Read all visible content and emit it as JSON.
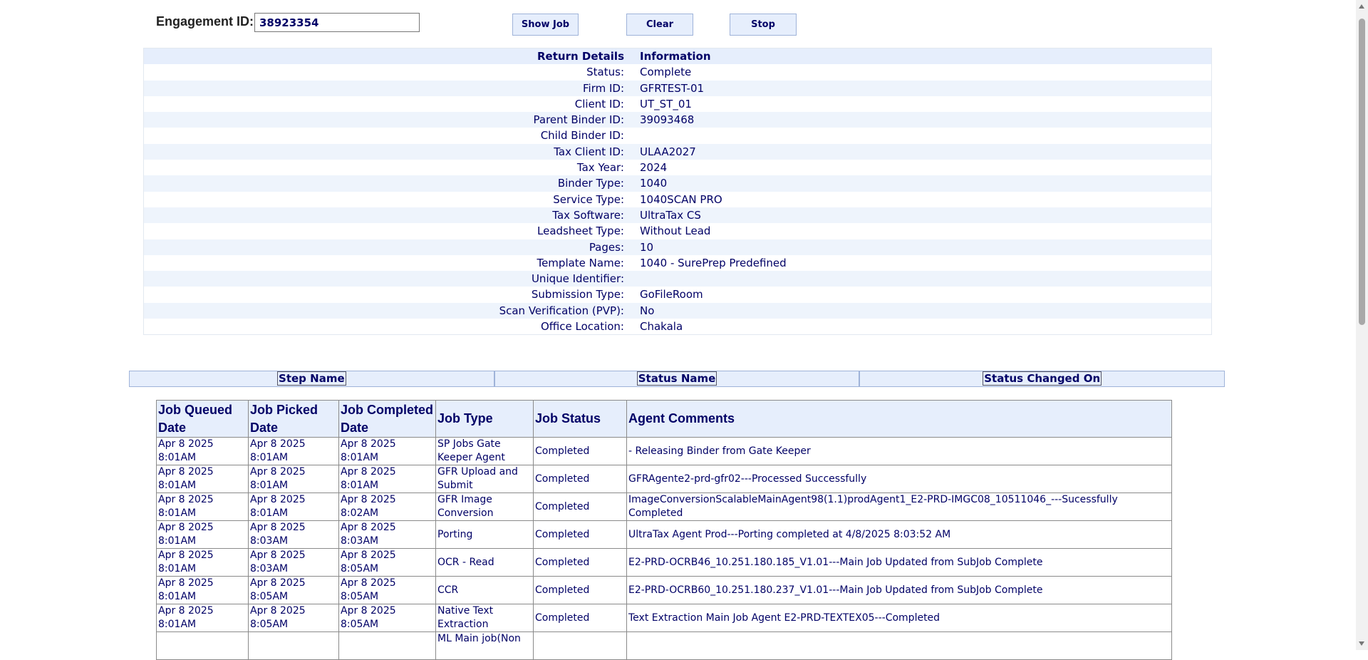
{
  "search": {
    "label": "Engagement ID:",
    "value": "38923354",
    "show_job_label": "Show Job",
    "clear_label": "Clear",
    "stop_label": "Stop"
  },
  "details": {
    "header_key": "Return Details",
    "header_value": "Information",
    "rows": [
      {
        "key": "Status:",
        "value": "Complete"
      },
      {
        "key": "Firm ID:",
        "value": "GFRTEST-01"
      },
      {
        "key": "Client ID:",
        "value": "UT_ST_01"
      },
      {
        "key": "Parent Binder ID:",
        "value": "39093468"
      },
      {
        "key": "Child Binder ID:",
        "value": ""
      },
      {
        "key": "Tax Client ID:",
        "value": "ULAA2027"
      },
      {
        "key": "Tax Year:",
        "value": "2024"
      },
      {
        "key": "Binder Type:",
        "value": "1040"
      },
      {
        "key": "Service Type:",
        "value": "1040SCAN PRO"
      },
      {
        "key": "Tax Software:",
        "value": "UltraTax CS"
      },
      {
        "key": "Leadsheet Type:",
        "value": "Without Lead"
      },
      {
        "key": "Pages:",
        "value": "10"
      },
      {
        "key": "Template Name:",
        "value": "1040 - SurePrep Predefined"
      },
      {
        "key": "Unique Identifier:",
        "value": ""
      },
      {
        "key": "Submission Type:",
        "value": "GoFileRoom"
      },
      {
        "key": "Scan Verification (PVP):",
        "value": "No"
      },
      {
        "key": "Office Location:",
        "value": "Chakala"
      }
    ]
  },
  "steps_header": {
    "step_name": "Step Name",
    "status_name": "Status Name",
    "status_changed_on": "Status Changed On"
  },
  "jobs": {
    "columns": [
      "Job Queued Date",
      "Job Picked Date",
      "Job Completed Date",
      "Job Type",
      "Job Status",
      "Agent Comments"
    ],
    "rows": [
      {
        "queued": "Apr 8 2025 8:01AM",
        "picked": "Apr 8 2025 8:01AM",
        "completed": "Apr 8 2025 8:01AM",
        "type": "SP Jobs Gate Keeper Agent",
        "status": "Completed",
        "comments": "- Releasing Binder from Gate Keeper"
      },
      {
        "queued": "Apr 8 2025 8:01AM",
        "picked": "Apr 8 2025 8:01AM",
        "completed": "Apr 8 2025 8:01AM",
        "type": "GFR Upload and Submit",
        "status": "Completed",
        "comments": "GFRAgente2-prd-gfr02---Processed Successfully"
      },
      {
        "queued": "Apr 8 2025 8:01AM",
        "picked": "Apr 8 2025 8:01AM",
        "completed": "Apr 8 2025 8:02AM",
        "type": "GFR Image Conversion",
        "status": "Completed",
        "comments": "ImageConversionScalableMainAgent98(1.1)prodAgent1_E2-PRD-IMGC08_10511046_---Sucessfully Completed"
      },
      {
        "queued": "Apr 8 2025 8:01AM",
        "picked": "Apr 8 2025 8:03AM",
        "completed": "Apr 8 2025 8:03AM",
        "type": "Porting",
        "status": "Completed",
        "comments": "UltraTax Agent Prod---Porting completed at 4/8/2025 8:03:52 AM"
      },
      {
        "queued": "Apr 8 2025 8:01AM",
        "picked": "Apr 8 2025 8:03AM",
        "completed": "Apr 8 2025 8:05AM",
        "type": "OCR - Read",
        "status": "Completed",
        "comments": "E2-PRD-OCRB46_10.251.180.185_V1.01---Main Job Updated from SubJob Complete"
      },
      {
        "queued": "Apr 8 2025 8:01AM",
        "picked": "Apr 8 2025 8:05AM",
        "completed": "Apr 8 2025 8:05AM",
        "type": "CCR",
        "status": "Completed",
        "comments": "E2-PRD-OCRB60_10.251.180.237_V1.01---Main Job Updated from SubJob Complete"
      },
      {
        "queued": "Apr 8 2025 8:01AM",
        "picked": "Apr 8 2025 8:05AM",
        "completed": "Apr 8 2025 8:05AM",
        "type": "Native Text Extraction",
        "status": "Completed",
        "comments": "Text Extraction Main Job Agent E2-PRD-TEXTEX05---Completed"
      },
      {
        "queued": "",
        "picked": "",
        "completed": "",
        "type": "ML Main job(Non",
        "status": "",
        "comments": ""
      }
    ]
  }
}
